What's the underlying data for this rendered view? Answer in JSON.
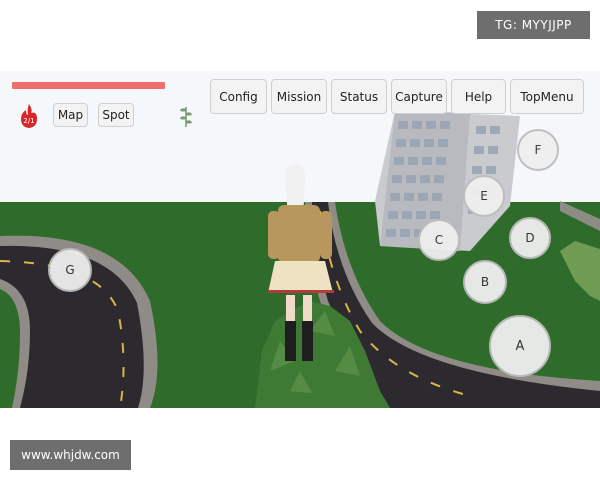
{
  "watermarks": {
    "top": "TG: MYYJJPP",
    "bottom": "www.whjdw.com"
  },
  "hud": {
    "health": 1.0,
    "player_badge": "2/1",
    "left_buttons": [
      {
        "key": "map",
        "label": "Map"
      },
      {
        "key": "spot",
        "label": "Spot"
      }
    ],
    "menu_buttons": [
      {
        "key": "config",
        "label": "Config"
      },
      {
        "key": "mission",
        "label": "Mission"
      },
      {
        "key": "status",
        "label": "Status"
      },
      {
        "key": "capture",
        "label": "Capture"
      },
      {
        "key": "help",
        "label": "Help"
      },
      {
        "key": "topmenu",
        "label": "TopMenu"
      }
    ],
    "action_buttons": {
      "a": "A",
      "b": "B",
      "c": "C",
      "d": "D",
      "e": "E",
      "f": "F",
      "g": "G"
    }
  },
  "colors": {
    "grass": "#2f6b2b",
    "road": "#2c2a2e",
    "curb": "#8f8b86",
    "sky": "#f4f8fb",
    "health": "#ef6f6c"
  }
}
